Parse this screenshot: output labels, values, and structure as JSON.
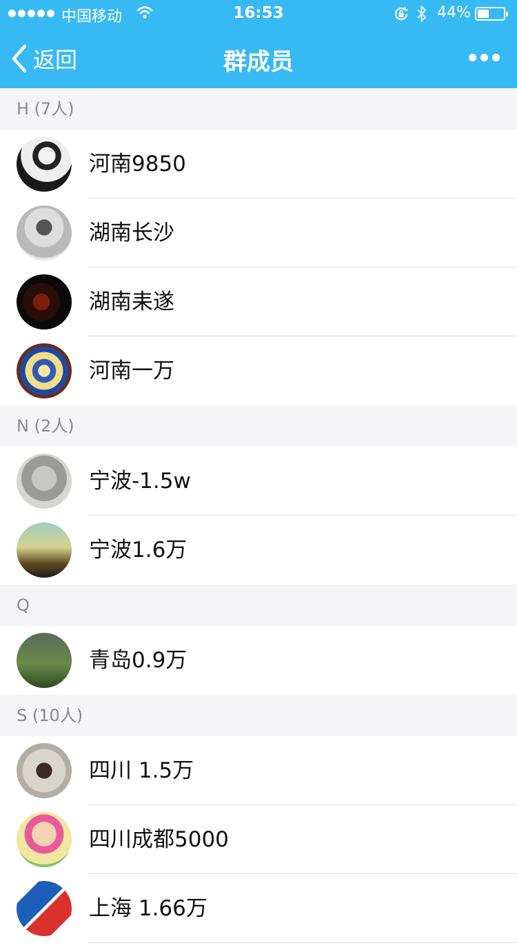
{
  "status": {
    "carrier": "中国移动",
    "time": "16:53",
    "battery_pct": "44%",
    "battery_level": 0.44,
    "icons": [
      "signal-dots-icon",
      "wifi-icon",
      "rotation-lock-icon",
      "bluetooth-icon",
      "battery-icon"
    ]
  },
  "nav": {
    "back_label": "返回",
    "title": "群成员",
    "more_icon": "more-dots-icon"
  },
  "colors": {
    "accent": "#37b9f4",
    "section_bg": "#f5f5f7",
    "section_text": "#8a8a8a",
    "separator": "#dcdcdc"
  },
  "sections": [
    {
      "header": "H (7人)",
      "members": [
        {
          "name": "河南9850"
        },
        {
          "name": "湖南长沙"
        },
        {
          "name": "湖南耒遂"
        },
        {
          "name": "河南一万"
        }
      ]
    },
    {
      "header": "N (2人)",
      "members": [
        {
          "name": "宁波-1.5w"
        },
        {
          "name": "宁波1.6万"
        }
      ]
    },
    {
      "header": "Q",
      "members": [
        {
          "name": "青岛0.9万"
        }
      ]
    },
    {
      "header": "S (10人)",
      "members": [
        {
          "name": "四川 1.5万"
        },
        {
          "name": "四川成都5000"
        },
        {
          "name": "上海 1.66万"
        }
      ]
    }
  ]
}
